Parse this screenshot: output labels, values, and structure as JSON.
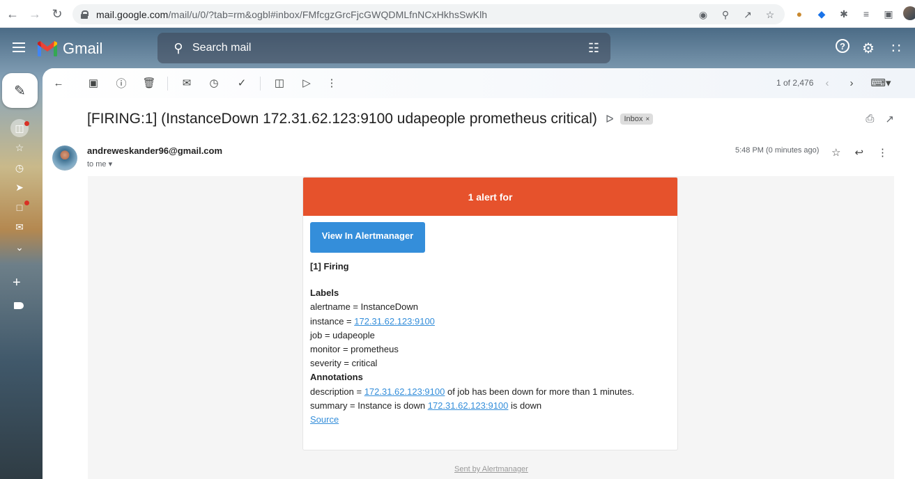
{
  "browser": {
    "url_host": "mail.google.com",
    "url_rest": "/mail/u/0/?tab=rm&ogbl#inbox/FMfcgzGrcFjcGWQDMLfnNCxHkhsSwKlh"
  },
  "gmail": {
    "logo_text": "Gmail",
    "search_placeholder": "Search mail"
  },
  "toolbar": {
    "pager_text": "1 of 2,476"
  },
  "message": {
    "subject": "[FIRING:1] (InstanceDown 172.31.62.123:9100 udapeople prometheus critical)",
    "label_chip": "Inbox",
    "label_chip_close": "×",
    "sender": "andreweskander96@gmail.com",
    "to": "to me",
    "time": "5:48 PM (0 minutes ago)"
  },
  "alert": {
    "header": "1 alert for",
    "button": "View In Alertmanager",
    "firing_title": "[1] Firing",
    "labels_title": "Labels",
    "alertname": "alertname = InstanceDown",
    "instance_prefix": "instance = ",
    "instance_link": "172.31.62.123:9100",
    "job": "job = udapeople",
    "monitor": "monitor = prometheus",
    "severity": "severity = critical",
    "annotations_title": "Annotations",
    "description_prefix": "description = ",
    "description_link": "172.31.62.123:9100",
    "description_suffix": " of job has been down for more than 1 minutes.",
    "summary_prefix": "summary = Instance is down ",
    "summary_link": "172.31.62.123:9100",
    "summary_suffix": " is down",
    "source_link": "Source",
    "footer": "Sent by Alertmanager"
  },
  "colors": {
    "alert_header": "#e6522c",
    "button": "#348eda",
    "unread_dot": "#d93025"
  }
}
